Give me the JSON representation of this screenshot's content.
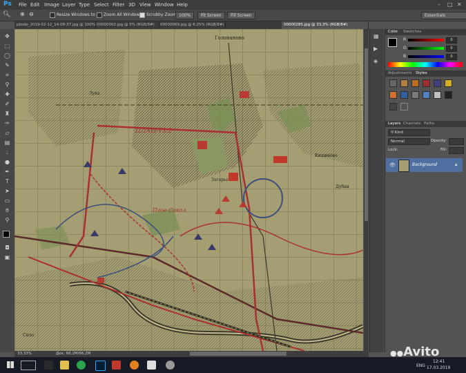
{
  "app": {
    "logo": "Ps"
  },
  "menu": [
    "File",
    "Edit",
    "Image",
    "Layer",
    "Type",
    "Select",
    "Filter",
    "3D",
    "View",
    "Window",
    "Help"
  ],
  "window_controls": {
    "minimize": "–",
    "maximize": "□",
    "close": "✕"
  },
  "options": {
    "resize_windows": "Resize Windows to Fit",
    "zoom_all": "Zoom All Windows",
    "scrubby_zoom": "Scrubby Zoom",
    "zoom_percent": "100%",
    "fit_screen": "Fit Screen",
    "fill_screen": "Fill Screen",
    "workspace": "Essentials"
  },
  "tabs": [
    {
      "label": "pbsdo_2019-02-12_14-08-37.jpg @ 100% (Layer 1, RGB/8#)"
    },
    {
      "label": "00000002.jpg @ 5% (RGB/8#)"
    },
    {
      "label": "00000069.jpg @ 6.25% (RGB/8#)"
    },
    {
      "label": "00000285.jpg @ 33,3% (RGB/8#)"
    }
  ],
  "status": {
    "zoom": "33,33%",
    "doc": "Док: 66,2M/66,2M"
  },
  "color_panel": {
    "tabs": [
      "Color",
      "Swatches"
    ],
    "r_label": "R",
    "g_label": "G",
    "b_label": "B",
    "r": "0",
    "g": "0",
    "b": "0"
  },
  "adjust_panel": {
    "tabs": [
      "Adjustments",
      "Styles"
    ]
  },
  "layers_panel": {
    "tabs": [
      "Layers",
      "Channels",
      "Paths"
    ],
    "kind": "Kind",
    "blend": "Normal",
    "opacity_label": "Opacity:",
    "lock_label": "Lock:",
    "fill_label": "Fill:",
    "layer_name": "Background"
  },
  "map_labels": {
    "top_village": "Голованово",
    "district": "ПЛАЦ-13.2",
    "label_a": "Загорье",
    "label_b": "Пгое Сокол",
    "label_c": "Кишинёво",
    "label_d": "Дубки",
    "label_e": "Лука",
    "label_f": "Сило"
  },
  "taskbar": {
    "lang": "ENG",
    "time": "12:41",
    "date": "17.03.2019"
  },
  "watermark": "Avito",
  "colors": {
    "map_bg": "#a49e72",
    "route_red": "#a83030",
    "route_blue": "#3a4f7a",
    "layer_selected": "#4f6fa0",
    "ps_blue": "#31a8ff"
  }
}
